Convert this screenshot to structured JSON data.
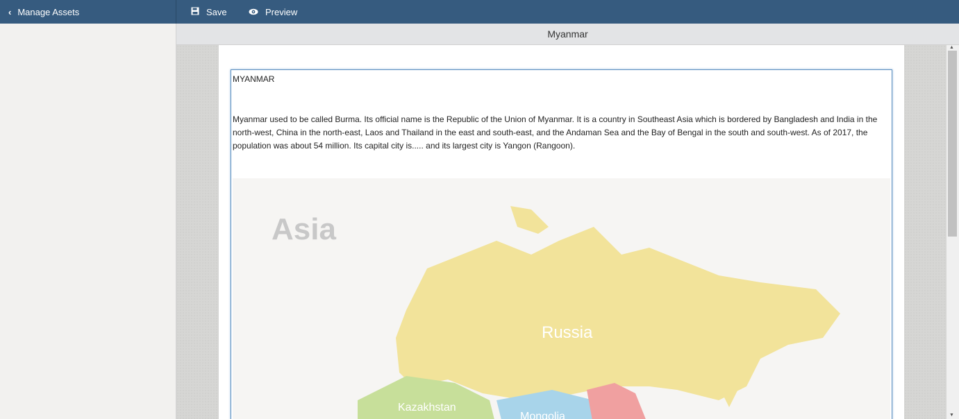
{
  "topbar": {
    "back_label": "Manage Assets",
    "save_label": "Save",
    "preview_label": "Preview",
    "bg_color": "#365b7f"
  },
  "document": {
    "title": "Myanmar",
    "heading": "MYANMAR",
    "body": "Myanmar used to be called Burma. Its official name is the Republic of the Union of Myanmar. It is a country in Southeast Asia which is bordered by Bangladesh and India in the north-west, China in the north-east, Laos and Thailand in the east and south-east, and the Andaman Sea and the Bay of Bengal in the south and south-west. As of 2017, the population was about 54 million. Its capital city is..... and its largest city is Yangon (Rangoon)."
  },
  "map": {
    "continent_label": "Asia",
    "labels": [
      "Russia",
      "Kazakhstan",
      "Mongolia"
    ]
  },
  "icons": {
    "back": "chevron-left-icon",
    "save": "floppy-disk-icon",
    "preview": "eye-icon"
  }
}
